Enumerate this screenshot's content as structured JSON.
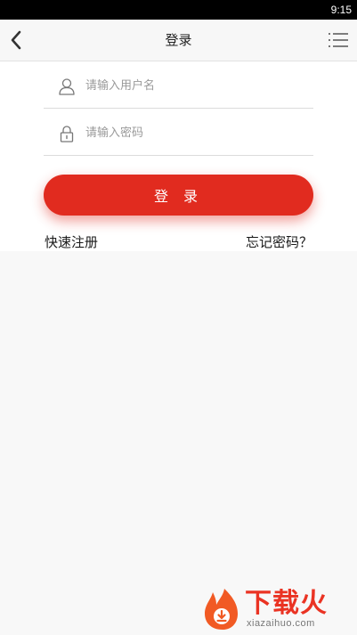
{
  "status_bar": {
    "time": "9:15"
  },
  "nav": {
    "title": "登录"
  },
  "form": {
    "username_placeholder": "请输入用户名",
    "password_placeholder": "请输入密码",
    "login_label": "登 录"
  },
  "links": {
    "register": "快速注册",
    "forgot_password": "忘记密码？"
  },
  "watermark": {
    "brand": "下载火",
    "domain": "xiazaihuo.com"
  },
  "colors": {
    "accent": "#e12b1f",
    "page_background": "#f8f8f8"
  },
  "icons": [
    "back-arrow-icon",
    "menu-list-icon",
    "user-icon",
    "lock-icon"
  ]
}
